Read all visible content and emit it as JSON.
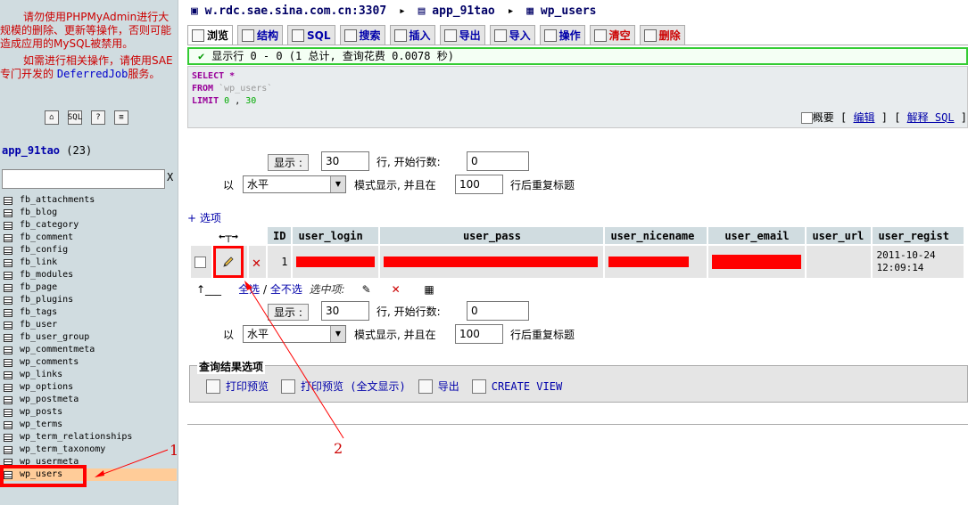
{
  "sidebar": {
    "warning_p1": "请勿使用PHPMyAdmin进行大规模的删除、更新等操作，否则可能造成应用的MySQL被禁用。",
    "warning_p2_prefix": "如需进行相关操作，请使用SAE专门开发的",
    "warning_p2_link": "DeferredJob",
    "warning_p2_suffix": "服务。",
    "icons": [
      "home-icon",
      "sql-icon",
      "query-icon",
      "docs-icon"
    ],
    "db_name": "app_91tao",
    "db_count": "(23)",
    "filter_clear": "X",
    "tables": [
      "fb_attachments",
      "fb_blog",
      "fb_category",
      "fb_comment",
      "fb_config",
      "fb_link",
      "fb_modules",
      "fb_page",
      "fb_plugins",
      "fb_tags",
      "fb_user",
      "fb_user_group",
      "wp_commentmeta",
      "wp_comments",
      "wp_links",
      "wp_options",
      "wp_postmeta",
      "wp_posts",
      "wp_terms",
      "wp_term_relationships",
      "wp_term_taxonomy",
      "wp_usermeta",
      "wp_users"
    ]
  },
  "breadcrumb": {
    "server": "w.rdc.sae.sina.com.cn:3307",
    "database": "app_91tao",
    "table": "wp_users"
  },
  "tabs": [
    "浏览",
    "结构",
    "SQL",
    "搜索",
    "插入",
    "导出",
    "导入",
    "操作",
    "清空",
    "删除"
  ],
  "notice": "显示行 0 - 0 (1 总计, 查询花费 0.0078 秒)",
  "sql": {
    "select": "SELECT",
    "star": "*",
    "from": "FROM",
    "table": "`wp_users`",
    "limit": "LIMIT",
    "offset": "0",
    "comma": ",",
    "count": "30"
  },
  "sql_options": {
    "profile": "概要",
    "edit": "编辑",
    "explain": "解释 SQL"
  },
  "nav": {
    "show_button": "显示 :",
    "rows_value": "30",
    "rows_label": "行, 开始行数:",
    "start_value": "0",
    "mode_prefix": "以",
    "mode_value": "水平",
    "mode_label": "模式显示, 并且在",
    "repeat_value": "100",
    "repeat_label": "行后重复标题"
  },
  "options_link": "+ 选项",
  "columns": [
    "ID",
    "user_login",
    "user_pass",
    "user_nicename",
    "user_email",
    "user_url",
    "user_regist"
  ],
  "row": {
    "id": "1",
    "registered_date": "2011-10-24",
    "registered_time": "12:09:14"
  },
  "bulk": {
    "check_all": "全选",
    "slash": "/",
    "uncheck_all": "全不选",
    "with_selected": "选中项:"
  },
  "query_results": {
    "legend": "查询结果选项",
    "print": "打印预览",
    "print_full": "打印预览 (全文显示)",
    "export": "导出",
    "create_view": "CREATE VIEW"
  },
  "annotations": {
    "one": "1",
    "two": "2"
  },
  "colors": {
    "accent_red": "#ff0000",
    "sidebar_bg": "#d0dce0",
    "link_blue": "#0000aa"
  }
}
